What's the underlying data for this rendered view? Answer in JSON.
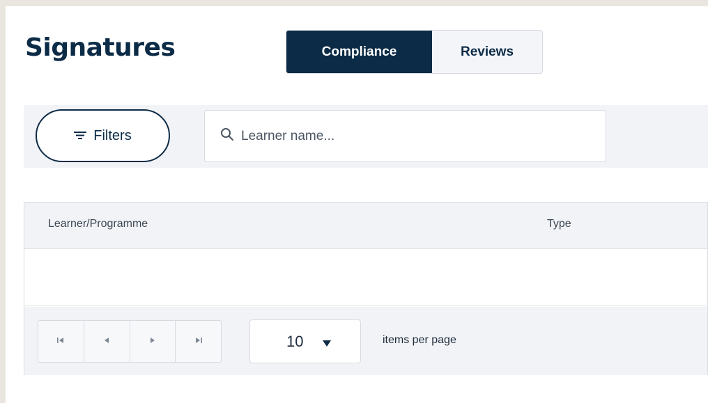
{
  "page": {
    "title": "Signatures"
  },
  "tabs": [
    {
      "label": "Compliance",
      "active": true
    },
    {
      "label": "Reviews",
      "active": false
    }
  ],
  "filters": {
    "button_label": "Filters",
    "search_placeholder": "Learner name...",
    "search_value": ""
  },
  "grid": {
    "columns": [
      "Learner/Programme",
      "Type"
    ],
    "rows": []
  },
  "pager": {
    "page_size": "10",
    "items_per_page_label": "items per page"
  },
  "icons": {
    "filter": "filter-lines-icon",
    "search": "search-icon",
    "first": "first-page-icon",
    "prev": "previous-page-icon",
    "next": "next-page-icon",
    "last": "last-page-icon",
    "dropdown": "caret-down-icon"
  },
  "colors": {
    "brand_navy": "#0c2b46",
    "background": "#e9e6df",
    "panel": "#f2f3f6"
  }
}
